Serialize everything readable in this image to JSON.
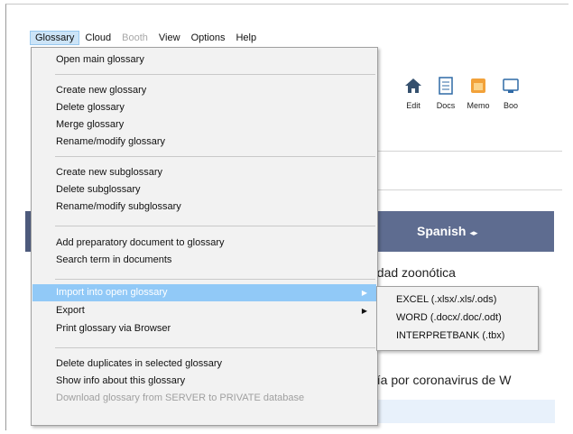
{
  "menubar": [
    {
      "label": "Glossary",
      "state": "active"
    },
    {
      "label": "Cloud",
      "state": "normal"
    },
    {
      "label": "Booth",
      "state": "disabled"
    },
    {
      "label": "View",
      "state": "normal"
    },
    {
      "label": "Options",
      "state": "normal"
    },
    {
      "label": "Help",
      "state": "normal"
    }
  ],
  "toolbar": [
    {
      "label": "Edit",
      "icon": "house-icon"
    },
    {
      "label": "Docs",
      "icon": "document-icon"
    },
    {
      "label": "Memo",
      "icon": "memo-icon"
    },
    {
      "label": "Boo",
      "icon": "booth-icon"
    }
  ],
  "language_header": {
    "label": "Spanish",
    "arrows": "◂▸"
  },
  "background_text": {
    "line1": "edad zoonótica",
    "line2": "nía por coronavirus de W"
  },
  "glossary_menu": [
    {
      "label": "Open main glossary"
    },
    {
      "sep": true
    },
    {
      "label": "Create new glossary"
    },
    {
      "label": "Delete glossary"
    },
    {
      "label": "Merge glossary"
    },
    {
      "label": "Rename/modify glossary"
    },
    {
      "sep": true
    },
    {
      "label": "Create new subglossary"
    },
    {
      "label": "Delete subglossary"
    },
    {
      "label": "Rename/modify subglossary"
    },
    {
      "sep": true
    },
    {
      "label": "Add preparatory document to glossary"
    },
    {
      "label": "Search term in documents"
    },
    {
      "sep": true
    },
    {
      "label": "Import into open glossary",
      "highlighted": true,
      "submenu": true
    },
    {
      "label": "Export",
      "submenu": true
    },
    {
      "label": "Print glossary via Browser"
    },
    {
      "sep": true
    },
    {
      "label": "Delete duplicates in selected glossary"
    },
    {
      "label": "Show info about this glossary"
    },
    {
      "label": "Download glossary from SERVER to PRIVATE database",
      "disabled": true
    }
  ],
  "import_submenu": [
    {
      "label": "EXCEL (.xlsx/.xls/.ods)"
    },
    {
      "label": "WORD (.docx/.doc/.odt)"
    },
    {
      "label": "INTERPRETBANK (.tbx)"
    }
  ],
  "colors": {
    "header_bar": "#5e6c90",
    "highlight": "#91c9f7",
    "menu_bg": "#f2f2f2"
  }
}
